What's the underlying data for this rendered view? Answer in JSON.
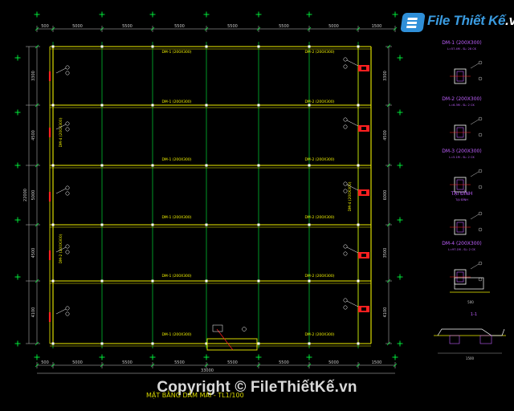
{
  "watermark": {
    "logo_text": "File Thiết Kế",
    "logo_suffix": ".vn",
    "copyright": "Copyright © FileThiếtKế.vn"
  },
  "drawing": {
    "title": "MẶT BẰNG DẦM MÁI - TL1/100",
    "top_dims": [
      "500",
      "5000",
      "5500",
      "5500",
      "5500",
      "5500",
      "5000",
      "1500"
    ],
    "bottom_dims": [
      "500",
      "5000",
      "5500",
      "5500",
      "5500",
      "5500",
      "5000",
      "1500"
    ],
    "total_width": "33000",
    "left_dims": [
      "3300",
      "4500",
      "5000",
      "4500",
      "4100"
    ],
    "left_total": "22000",
    "right_dims": [
      "3300",
      "4500",
      "6000",
      "3500",
      "4100"
    ],
    "beam_labels": [
      "DM-1 (200X300)",
      "DM-2 (200X300)",
      "DM-3 (200X300)",
      "DM-4 (200X300)"
    ],
    "section_titles": [
      "DM-1 (200X300)",
      "DM-2 (200X300)",
      "DM-3 (200X300)",
      "TẠI ĐỈNH",
      "DM-4 (200X300)"
    ],
    "section_notes": [
      "L=57.4M - SL: 28 CK",
      "L=6.3M - SL: 2 CK",
      "L=5.1M - SL: 2 CK",
      "TẠI ĐỈNH",
      "L=97.1M - SL: 2 CK"
    ],
    "detail_labels": [
      "1-1",
      "500",
      "1500"
    ],
    "colors": {
      "background": "#000000",
      "axis": "#00ff40",
      "dim": "#cccccc",
      "beam": "#f0f000",
      "rebar": "#ff2020",
      "column": "#ffffff",
      "detail": "#c060ff"
    }
  }
}
